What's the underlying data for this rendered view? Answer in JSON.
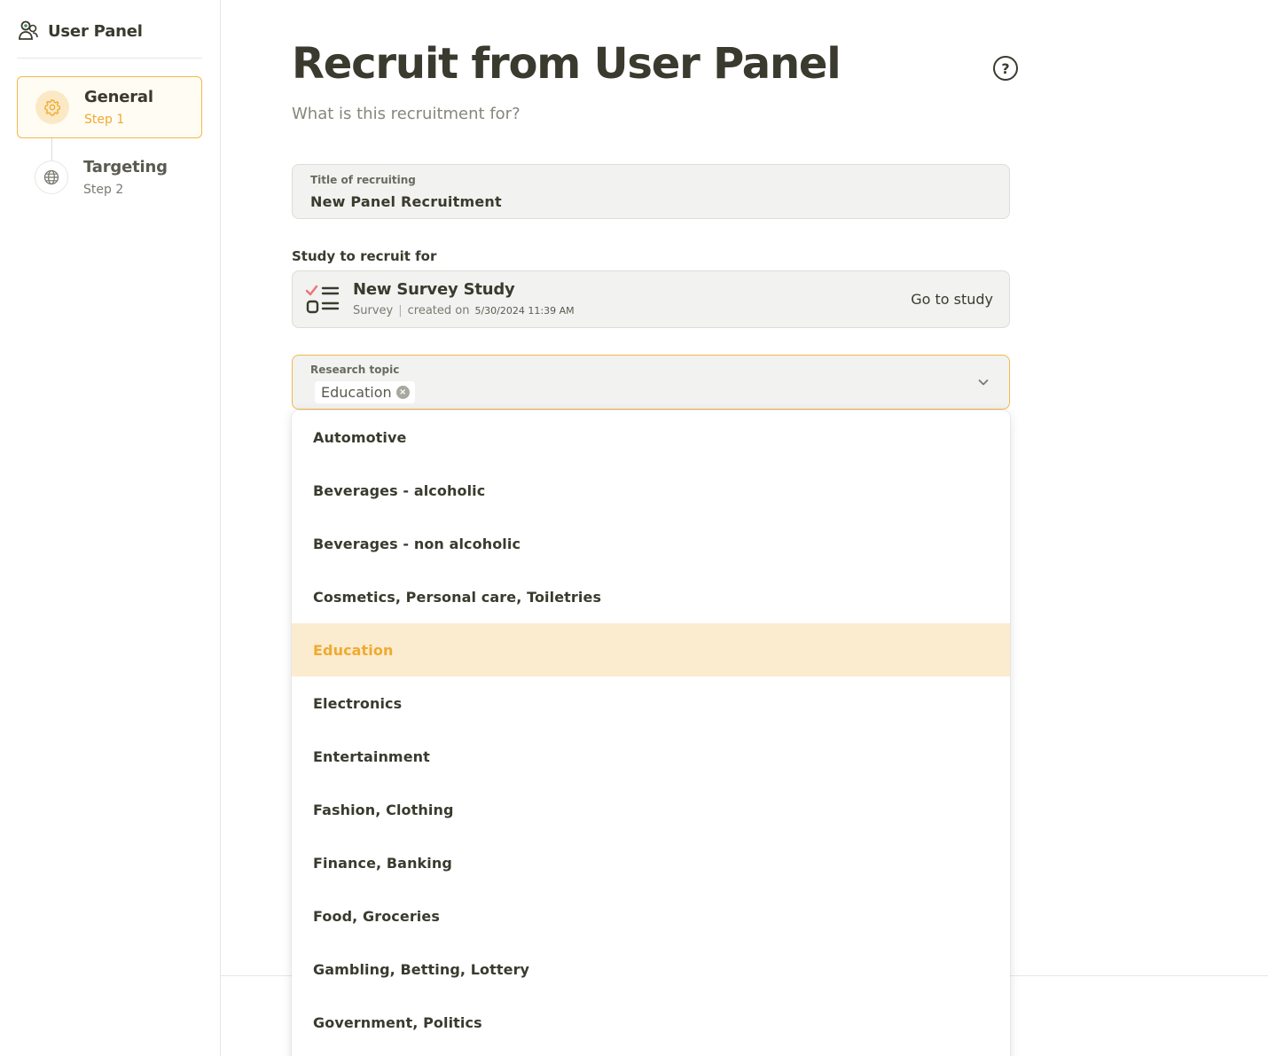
{
  "brand": {
    "name": "User Panel",
    "icon": "users-icon"
  },
  "steps": [
    {
      "title": "General",
      "subtitle": "Step 1",
      "icon": "gear-icon",
      "active": true
    },
    {
      "title": "Targeting",
      "subtitle": "Step 2",
      "icon": "globe-icon",
      "active": false
    }
  ],
  "page": {
    "title": "Recruit from User Panel",
    "subtitle": "What is this recruitment for?",
    "help_symbol": "?"
  },
  "title_field": {
    "label": "Title of recruiting",
    "value": "New Panel Recruitment"
  },
  "study": {
    "section_label": "Study to recruit for",
    "name": "New Survey Study",
    "type": "Survey",
    "separator": "|",
    "created_label": "created on",
    "created_date": "5/30/2024 11:39 AM",
    "link_label": "Go to study"
  },
  "topic": {
    "label": "Research topic",
    "selected_chip": "Education",
    "chip_remove": "×"
  },
  "dropdown_options": [
    {
      "label": "Automotive"
    },
    {
      "label": "Beverages - alcoholic"
    },
    {
      "label": "Beverages - non alcoholic"
    },
    {
      "label": "Cosmetics, Personal care, Toiletries"
    },
    {
      "label": "Education",
      "selected": true
    },
    {
      "label": "Electronics"
    },
    {
      "label": "Entertainment"
    },
    {
      "label": "Fashion, Clothing"
    },
    {
      "label": "Finance, Banking"
    },
    {
      "label": "Food, Groceries"
    },
    {
      "label": "Gambling, Betting, Lottery"
    },
    {
      "label": "Government, Politics"
    }
  ],
  "colors": {
    "accent": "#f0aa2f",
    "accent_border": "#f3b84a",
    "selected_bg": "#fbebcf",
    "text": "#3a3a2e",
    "field_bg": "#f2f2f0"
  }
}
